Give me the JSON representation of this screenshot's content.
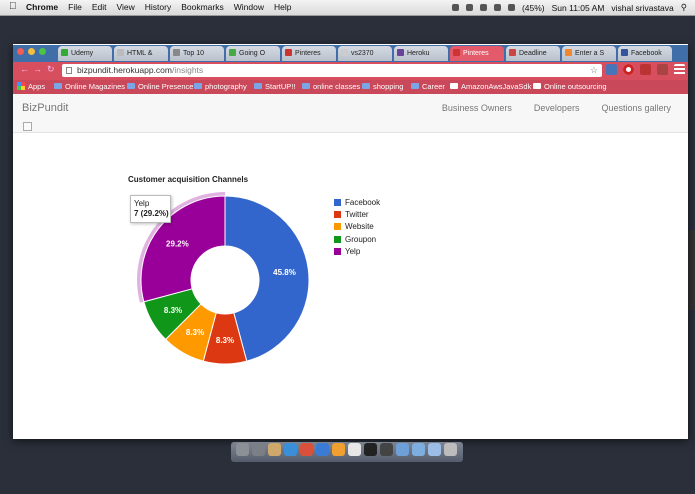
{
  "menubar": {
    "items": [
      "Chrome",
      "File",
      "Edit",
      "View",
      "History",
      "Bookmarks",
      "Window",
      "Help"
    ],
    "battery": "(45%)",
    "clock": "Sun 11:05 AM",
    "user": "vishal srivastava"
  },
  "tabs": [
    {
      "label": "Udemy",
      "color": "#3a3"
    },
    {
      "label": "HTML &",
      "color": "#bbb"
    },
    {
      "label": "Top 10",
      "color": "#888"
    },
    {
      "label": "Going O",
      "color": "#4a4"
    },
    {
      "label": "Pinteres",
      "color": "#c33"
    },
    {
      "label": "vs2370",
      "color": "#ccc"
    },
    {
      "label": "Heroku",
      "color": "#649"
    },
    {
      "label": "Pinteres",
      "color": "#c33"
    },
    {
      "label": "Deadline",
      "color": "#c44"
    },
    {
      "label": "Enter a S",
      "color": "#e83"
    },
    {
      "label": "Facebook",
      "color": "#359"
    }
  ],
  "address": {
    "host": "bizpundit.herokuapp.com",
    "path": "/insights"
  },
  "bookmarks": [
    {
      "label": "Apps",
      "kind": "grid"
    },
    {
      "label": "Online Magazines",
      "kind": "folder"
    },
    {
      "label": "Online Presence",
      "kind": "folder"
    },
    {
      "label": "photography",
      "kind": "folder"
    },
    {
      "label": "StartUP!!",
      "kind": "folder"
    },
    {
      "label": "online classes",
      "kind": "folder"
    },
    {
      "label": "shopping",
      "kind": "folder"
    },
    {
      "label": "Career",
      "kind": "folder"
    },
    {
      "label": "AmazonAwsJavaSdk",
      "kind": "link"
    },
    {
      "label": "Online outsourcing",
      "kind": "link"
    }
  ],
  "site": {
    "brand": "BizPundit",
    "nav": [
      "Business Owners",
      "Developers",
      "Questions gallery"
    ]
  },
  "chart_data": {
    "type": "pie",
    "title": "Customer acquisition Channels",
    "donut": true,
    "slices": [
      {
        "name": "Facebook",
        "value": 11,
        "percent_label": "45.8%",
        "color": "#3366cc"
      },
      {
        "name": "Twitter",
        "value": 2,
        "percent_label": "8.3%",
        "color": "#dc3912"
      },
      {
        "name": "Website",
        "value": 2,
        "percent_label": "8.3%",
        "color": "#ff9900"
      },
      {
        "name": "Groupon",
        "value": 2,
        "percent_label": "8.3%",
        "color": "#109618"
      },
      {
        "name": "Yelp",
        "value": 7,
        "percent_label": "29.2%",
        "color": "#990099"
      }
    ],
    "legend_position": "right",
    "highlighted": "Yelp",
    "tooltip": {
      "name": "Yelp",
      "text": "7 (29.2%)"
    }
  }
}
